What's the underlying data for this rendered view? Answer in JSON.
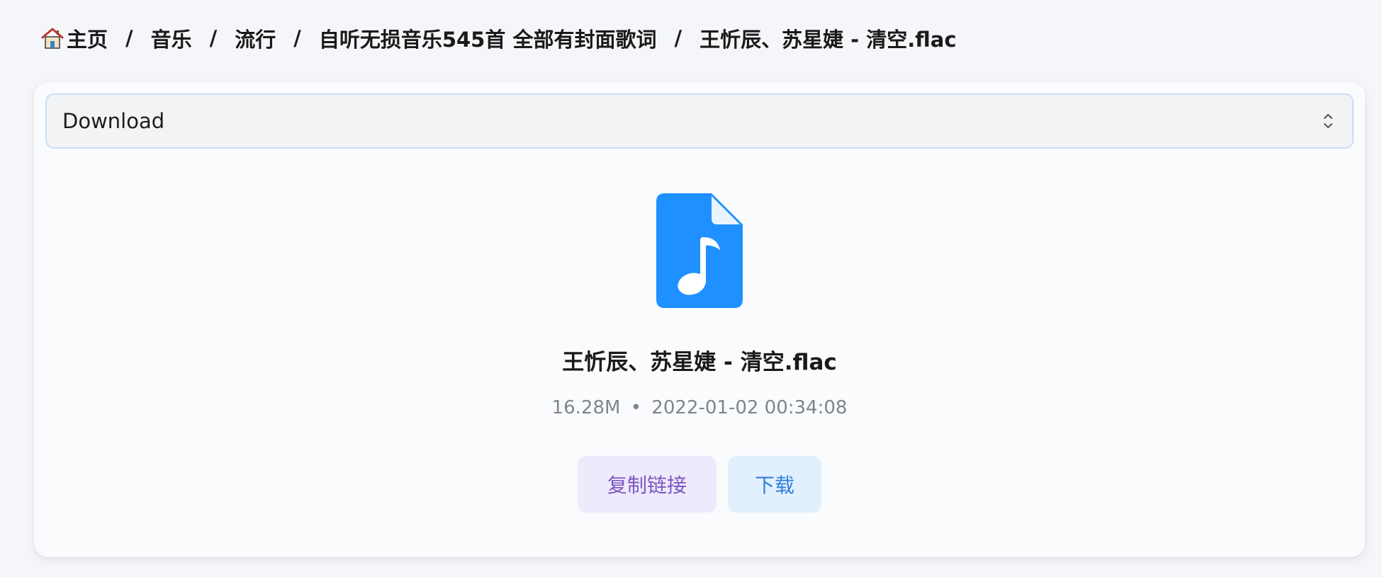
{
  "breadcrumb": {
    "items": [
      {
        "label": "主页",
        "icon": "home-icon"
      },
      {
        "label": "音乐"
      },
      {
        "label": "流行"
      },
      {
        "label": "自听无损音乐545首 全部有封面歌词"
      },
      {
        "label": "王忻辰、苏星婕 - 清空.flac"
      }
    ],
    "separator": "/"
  },
  "select": {
    "value": "Download",
    "icon": "chevron-up-down-icon"
  },
  "file": {
    "icon": "music-file-icon",
    "icon_color": "#1e90ff",
    "name": "王忻辰、苏星婕 - 清空.flac",
    "size": "16.28M",
    "separator": "•",
    "modified": "2022-01-02 00:34:08"
  },
  "actions": {
    "copy_label": "复制链接",
    "download_label": "下载"
  },
  "colors": {
    "accent": "#1e90ff",
    "copy_bg": "#eee9fb",
    "copy_text": "#7d56c2",
    "download_bg": "#e2effd",
    "download_text": "#2f7fd9"
  }
}
